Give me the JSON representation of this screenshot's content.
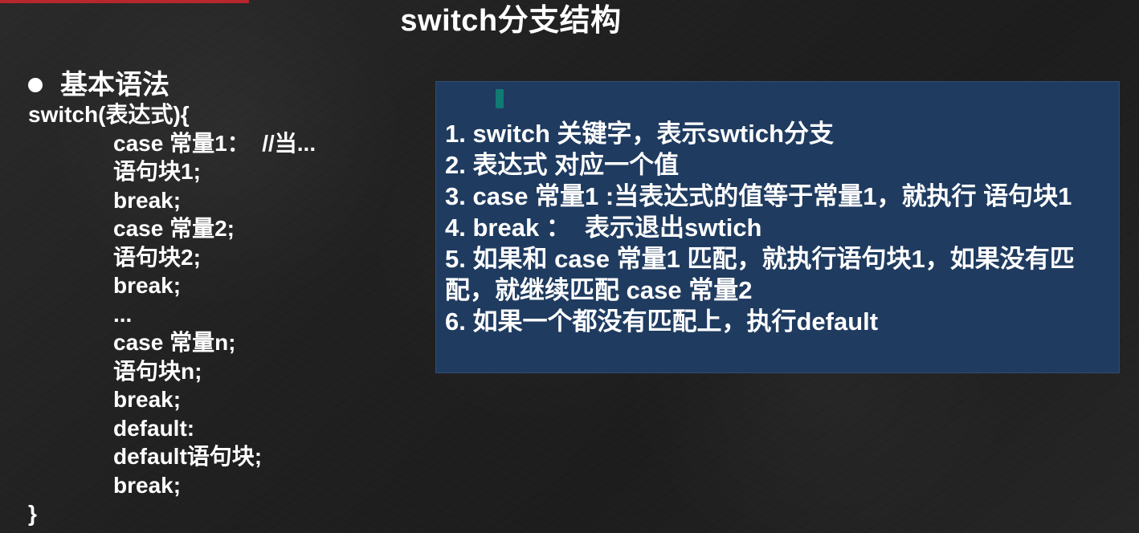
{
  "slide": {
    "title": "switch分支结构",
    "heading": "基本语法",
    "code_lines": [
      "switch(表达式){",
      "case 常量1：  //当...",
      "语句块1;",
      "break;",
      "case 常量2;",
      "语句块2;",
      "break;",
      "...",
      "case 常量n;",
      "语句块n;",
      "break;",
      "default:",
      "default语句块;",
      "break;",
      "}"
    ],
    "info_lines": [
      "1. switch 关键字，表示swtich分支",
      "2. 表达式 对应一个值",
      "3. case 常量1 :当表达式的值等于常量1，就执行 语句块1",
      "4. break ：  表示退出swtich",
      "5. 如果和 case 常量1 匹配，就执行语句块1，如果没有匹配，就继续匹配 case 常量2",
      "6. 如果一个都没有匹配上，执行default"
    ],
    "colors": {
      "background": "#232323",
      "accent": "#b7272c",
      "info_box": "#1f3b60",
      "text": "#ffffff"
    }
  }
}
